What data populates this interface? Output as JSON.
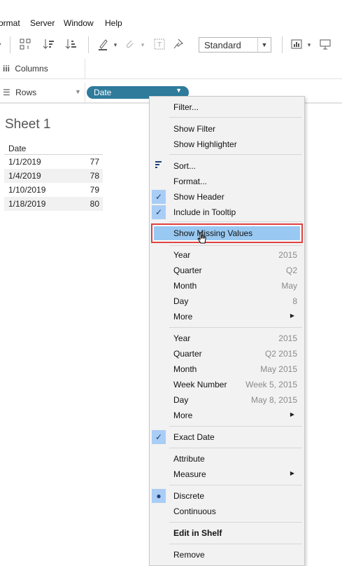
{
  "menubar": {
    "items": [
      "ormat",
      "Server",
      "Window",
      "Help"
    ]
  },
  "toolbar": {
    "fit_combo_value": "Standard"
  },
  "shelves": {
    "columns_label": "Columns",
    "rows_label": "Rows",
    "rows_pill": "Date"
  },
  "sheet": {
    "title": "Sheet 1",
    "column_header": "Date",
    "rows": [
      {
        "date": "1/1/2019",
        "value": "77"
      },
      {
        "date": "1/4/2019",
        "value": "78"
      },
      {
        "date": "1/10/2019",
        "value": "79"
      },
      {
        "date": "1/18/2019",
        "value": "80"
      }
    ]
  },
  "context_menu": {
    "filter": "Filter...",
    "show_filter": "Show Filter",
    "show_highlighter": "Show Highlighter",
    "sort": "Sort...",
    "format": "Format...",
    "show_header": "Show Header",
    "include_in_tooltip": "Include in Tooltip",
    "show_missing_values": "Show Missing Values",
    "discrete_date_parts": [
      {
        "label": "Year",
        "value": "2015"
      },
      {
        "label": "Quarter",
        "value": "Q2"
      },
      {
        "label": "Month",
        "value": "May"
      },
      {
        "label": "Day",
        "value": "8"
      },
      {
        "label": "More",
        "value": ""
      }
    ],
    "continuous_date_parts": [
      {
        "label": "Year",
        "value": "2015"
      },
      {
        "label": "Quarter",
        "value": "Q2 2015"
      },
      {
        "label": "Month",
        "value": "May 2015"
      },
      {
        "label": "Week Number",
        "value": "Week 5, 2015"
      },
      {
        "label": "Day",
        "value": "May 8, 2015"
      },
      {
        "label": "More",
        "value": ""
      }
    ],
    "exact_date": "Exact Date",
    "attribute": "Attribute",
    "measure": "Measure",
    "discrete": "Discrete",
    "continuous": "Continuous",
    "edit_in_shelf": "Edit in Shelf",
    "remove": "Remove"
  },
  "colors": {
    "pill": "#2e7b9c",
    "menu_highlight": "#99c9f2",
    "highlight_border": "#e04040"
  }
}
